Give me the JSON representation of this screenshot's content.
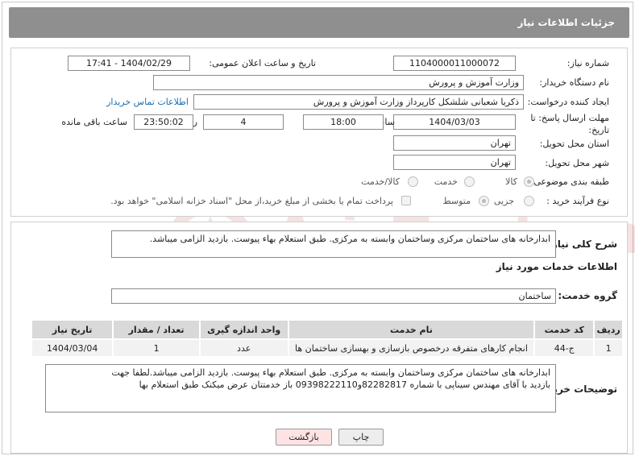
{
  "header": {
    "title": "جزئیات اطلاعات نیاز"
  },
  "form": {
    "need_number_label": "شماره نیاز:",
    "need_number": "1104000011000072",
    "announce_label": "تاریخ و ساعت اعلان عمومی:",
    "announce_value": "1404/02/29 - 17:41",
    "buyer_org_label": "نام دستگاه خریدار:",
    "buyer_org": "وزارت آموزش و پرورش",
    "creator_label": "ایجاد کننده درخواست:",
    "creator": "ذکریا شعبانی شلشکل کارپرداز وزارت آموزش و پرورش",
    "contact_link": "اطلاعات تماس خریدار",
    "deadline_label_1": "مهلت ارسال پاسخ: تا",
    "deadline_label_2": "تاریخ:",
    "deadline_date": "1404/03/03",
    "time_label": "ساعت",
    "deadline_time": "18:00",
    "days_value": "4",
    "days_label": "روز و",
    "remaining_time": "23:50:02",
    "remaining_label": "ساعت باقی مانده",
    "province_label": "استان محل تحویل:",
    "province": "تهران",
    "city_label": "شهر محل تحویل:",
    "city": "تهران",
    "category_label": "طبقه بندی موضوعی:",
    "category_options": [
      "کالا",
      "خدمت",
      "کالا/خدمت"
    ],
    "process_label": "نوع فرآیند خرید :",
    "process_options": [
      "جزیی",
      "متوسط"
    ],
    "payment_note": "پرداخت تمام یا بخشی از مبلغ خرید،از محل \"اسناد خزانه اسلامی\" خواهد بود."
  },
  "summary": {
    "label": "شرح کلی نیاز:",
    "text": "ابدارخانه های ساختمان مرکزی وساختمان وابسته به مرکزی. طبق استعلام بهاء پیوست. بازدید الزامی میباشد."
  },
  "services": {
    "title": "اطلاعات خدمات مورد نیاز",
    "group_label": "گروه خدمت:",
    "group_value": "ساختمان",
    "columns": [
      "ردیف",
      "کد خدمت",
      "نام خدمت",
      "واحد اندازه گیری",
      "تعداد / مقدار",
      "تاریخ نیاز"
    ],
    "rows": [
      [
        "1",
        "ج-44",
        "انجام کارهای متفرقه درخصوص بازسازی و بهسازی ساختمان ها",
        "عدد",
        "1",
        "1404/03/04"
      ]
    ]
  },
  "notes": {
    "label": "توضیحات خریدار:",
    "line1": "ابدارخانه های ساختمان مرکزی وساختمان وابسته به مرکزی. طبق استعلام بهاء پیوست. بازدید الزامی میباشد.لطفا جهت",
    "line2": "بازدید با آقای مهندس سیناپی با شماره 82282817و09398222110 باز خدمتتان عرض میکنک طبق استعلام بها"
  },
  "buttons": {
    "print": "چاپ",
    "back": "بازگشت"
  },
  "watermark": {
    "text": "AriaTender.neT"
  },
  "colors": {
    "header_bg": "#8f8f8f",
    "link": "#1a6fb5",
    "back_button": "#fde3e3",
    "watermark": "#c2262a"
  }
}
